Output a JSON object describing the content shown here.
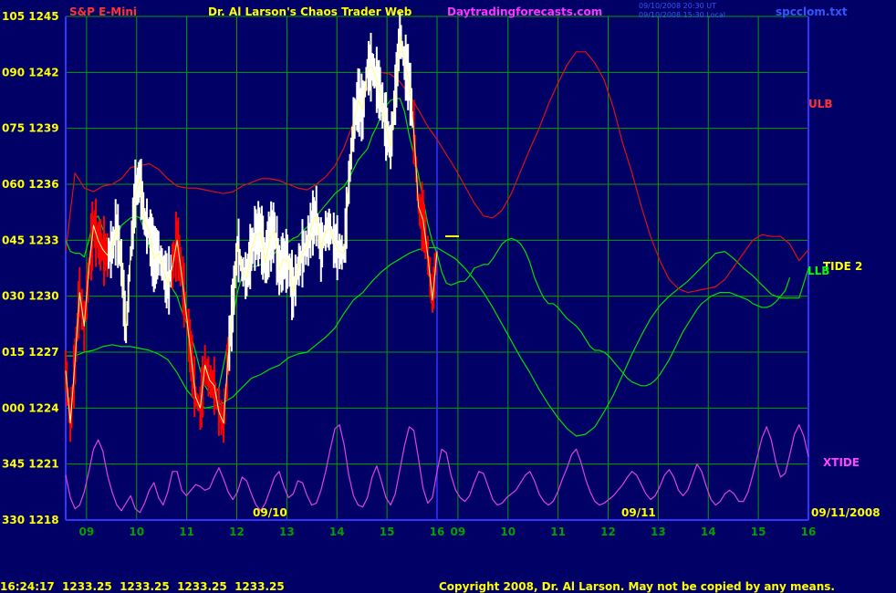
{
  "header": {
    "symbol": "S&P E-Mini",
    "title": "Dr. Al Larson's Chaos Trader Web",
    "site": "Daytradingforecasts.com",
    "stamp1": "09/10/2008 20:30 UT",
    "stamp2": "09/10/2008 15:30 Local",
    "file": "spcclom.txt"
  },
  "footer": {
    "quote": "16:24:17  1233.25  1233.25  1233.25  1233.25",
    "copyright": "Copyright 2008, Dr. Al Larson. May not be copied by any means."
  },
  "colors": {
    "background": "#000066",
    "grid": "#00a000",
    "axis": "#3333ff",
    "price_white": "#ffffff",
    "price_red": "#ff0000",
    "ulb": "#dd1111",
    "llb": "#00dd00",
    "xtide": "#dd44dd",
    "labels": "#ffff00"
  },
  "chart_data": {
    "type": "line",
    "y_tick_labels": [
      "105 1245",
      "090 1242",
      "075 1239",
      "060 1236",
      "045 1233",
      "030 1230",
      "015 1227",
      "000 1224",
      "345 1221",
      "330 1218"
    ],
    "x_tick_labels": [
      "09",
      "10",
      "11",
      "12",
      "13",
      "14",
      "15",
      "16",
      "09",
      "10",
      "11",
      "12",
      "13",
      "14",
      "15",
      "16"
    ],
    "date_labels": [
      "09/10",
      "09/11",
      "09/11/2008"
    ],
    "ylim": [
      1218,
      1245
    ],
    "series_labels": {
      "ulb": "ULB",
      "llb": "LLB",
      "tide": "TIDE 2",
      "xtide": "XTIDE"
    },
    "x_units": "slot (0 = left edge, 16 = right edge; day 1 09-16h = slots 0.45-8, day 2 09-16h = slots 8.45-16)",
    "price": {
      "x": [
        0.0,
        0.1,
        0.2,
        0.3,
        0.4,
        0.5,
        0.6,
        0.7,
        0.8,
        0.9,
        1.0,
        1.1,
        1.2,
        1.3,
        1.4,
        1.5,
        1.6,
        1.7,
        1.8,
        1.9,
        2.0,
        2.1,
        2.2,
        2.3,
        2.4,
        2.5,
        2.6,
        2.7,
        2.8,
        2.9,
        3.0,
        3.1,
        3.2,
        3.3,
        3.4,
        3.5,
        3.6,
        3.7,
        3.8,
        3.9,
        4.0,
        4.1,
        4.2,
        4.3,
        4.4,
        4.5,
        4.6,
        4.7,
        4.8,
        4.9,
        5.0,
        5.1,
        5.2,
        5.3,
        5.4,
        5.5,
        5.6,
        5.7,
        5.8,
        5.9,
        6.0,
        6.1,
        6.2,
        6.3,
        6.4,
        6.5,
        6.6,
        6.7,
        6.8,
        6.9,
        7.0,
        7.1,
        7.2,
        7.3,
        7.4,
        7.5,
        7.6,
        7.7,
        7.8,
        7.9,
        8.0
      ],
      "y": [
        1226.0,
        1223.2,
        1226.5,
        1230.2,
        1228.4,
        1231.5,
        1233.8,
        1233.0,
        1232.5,
        1232.2,
        1232.6,
        1233.7,
        1231.8,
        1228.0,
        1232.3,
        1235.5,
        1236.3,
        1234.0,
        1233.5,
        1232.0,
        1232.3,
        1231.5,
        1230.6,
        1231.6,
        1233.0,
        1231.1,
        1229.0,
        1226.8,
        1224.6,
        1224.0,
        1226.3,
        1225.5,
        1225.2,
        1223.8,
        1223.2,
        1226.8,
        1229.5,
        1232.8,
        1231.4,
        1231.0,
        1232.5,
        1233.3,
        1233.4,
        1231.8,
        1233.1,
        1233.5,
        1231.4,
        1232.0,
        1231.8,
        1230.2,
        1231.5,
        1232.3,
        1232.7,
        1233.8,
        1234.3,
        1232.5,
        1233.5,
        1233.6,
        1232.8,
        1232.4,
        1232.3,
        1236.1,
        1239.2,
        1240.5,
        1240.0,
        1242.2,
        1242.3,
        1241.6,
        1240.6,
        1239.1,
        1238.0,
        1240.8,
        1244.0,
        1242.5,
        1241.5,
        1238.8,
        1234.8,
        1234.1,
        1232.2,
        1229.8,
        1232.4
      ]
    },
    "ulb": {
      "x": [
        0.0,
        0.2,
        0.4,
        0.6,
        0.8,
        1.0,
        1.2,
        1.4,
        1.6,
        1.8,
        2.0,
        2.2,
        2.4,
        2.6,
        2.8,
        3.0,
        3.2,
        3.4,
        3.6,
        3.8,
        4.0,
        4.2,
        4.4,
        4.6,
        4.8,
        5.0,
        5.2,
        5.4,
        5.6,
        5.8,
        6.0,
        6.2,
        6.4,
        6.6,
        6.8,
        7.0,
        7.2,
        7.4,
        7.6,
        7.8,
        8.0,
        8.2,
        8.4,
        8.6,
        8.8,
        9.0,
        9.2,
        9.4,
        9.6,
        9.8,
        10.0,
        10.2,
        10.4,
        10.6,
        10.8,
        11.0,
        11.2,
        11.4,
        11.6,
        11.8,
        12.0,
        12.2,
        12.4,
        12.6,
        12.8,
        13.0,
        13.2,
        13.4,
        13.6,
        13.8,
        14.0,
        14.2,
        14.4,
        14.6,
        14.8,
        15.0,
        15.2,
        15.4,
        15.6,
        15.8,
        16.0
      ],
      "y": [
        1232.4,
        1236.6,
        1235.8,
        1235.6,
        1235.9,
        1236.0,
        1236.3,
        1236.9,
        1237.0,
        1237.1,
        1236.8,
        1236.3,
        1235.9,
        1235.8,
        1235.8,
        1235.7,
        1235.6,
        1235.5,
        1235.6,
        1235.9,
        1236.1,
        1236.3,
        1236.3,
        1236.2,
        1236.0,
        1235.8,
        1235.7,
        1236.0,
        1236.4,
        1237.0,
        1238.0,
        1239.3,
        1240.6,
        1241.7,
        1242.0,
        1241.9,
        1241.5,
        1240.8,
        1240.0,
        1239.1,
        1238.4,
        1237.6,
        1236.8,
        1235.9,
        1235.0,
        1234.3,
        1234.2,
        1234.6,
        1235.5,
        1236.7,
        1237.9,
        1239.0,
        1240.3,
        1241.4,
        1242.4,
        1243.1,
        1243.1,
        1242.5,
        1241.6,
        1240.1,
        1238.2,
        1236.6,
        1234.8,
        1233.2,
        1231.9,
        1230.9,
        1230.4,
        1230.2,
        1230.3,
        1230.4,
        1230.5,
        1230.9,
        1231.6,
        1232.3,
        1233.0,
        1233.3,
        1233.2,
        1233.2,
        1232.8,
        1231.9,
        1232.5
      ]
    },
    "llb": {
      "x": [
        0.0,
        0.2,
        0.4,
        0.6,
        0.8,
        1.0,
        1.2,
        1.4,
        1.6,
        1.8,
        2.0,
        2.2,
        2.4,
        2.6,
        2.8,
        3.0,
        3.2,
        3.4,
        3.6,
        3.8,
        4.0,
        4.2,
        4.4,
        4.6,
        4.8,
        5.0,
        5.2,
        5.4,
        5.6,
        5.8,
        6.0,
        6.2,
        6.4,
        6.6,
        6.8,
        7.0,
        7.2,
        7.4,
        7.6,
        7.8,
        8.0,
        8.2,
        8.4,
        8.6,
        8.8,
        9.0,
        9.2,
        9.4,
        9.6,
        9.8,
        10.0,
        10.2,
        10.4,
        10.6,
        10.8,
        11.0,
        11.2,
        11.4,
        11.6,
        11.8,
        12.0,
        12.2,
        12.4,
        12.6,
        12.8,
        13.0,
        13.2,
        13.4,
        13.6,
        13.8,
        14.0,
        14.2,
        14.4,
        14.6,
        14.8,
        15.0,
        15.2,
        15.4,
        15.6,
        15.8,
        16.0
      ],
      "y": [
        1226.8,
        1226.8,
        1227.0,
        1227.1,
        1227.3,
        1227.4,
        1227.3,
        1227.3,
        1227.2,
        1227.1,
        1226.9,
        1226.6,
        1225.9,
        1225.0,
        1224.4,
        1224.0,
        1224.1,
        1224.3,
        1224.6,
        1225.1,
        1225.6,
        1225.8,
        1226.1,
        1226.3,
        1226.7,
        1226.9,
        1227.0,
        1227.4,
        1227.8,
        1228.3,
        1229.1,
        1229.8,
        1230.2,
        1230.8,
        1231.3,
        1231.7,
        1232.0,
        1232.3,
        1232.5,
        1232.6,
        1232.6,
        1232.3,
        1232.0,
        1231.5,
        1230.9,
        1230.2,
        1229.4,
        1228.5,
        1227.6,
        1226.7,
        1225.9,
        1225.0,
        1224.2,
        1223.5,
        1222.9,
        1222.5,
        1222.6,
        1223.0,
        1223.8,
        1224.7,
        1225.8,
        1226.9,
        1227.9,
        1228.8,
        1229.5,
        1230.0,
        1230.4,
        1230.8,
        1231.3,
        1231.8,
        1232.3,
        1232.4,
        1232.0,
        1231.5,
        1231.1,
        1230.6,
        1230.1,
        1229.9,
        1229.9,
        1229.9,
        1231.5
      ]
    },
    "tide": {
      "x": [
        0.0,
        0.1,
        0.2,
        0.3,
        0.4,
        0.5,
        0.6,
        0.7,
        0.8,
        0.9,
        1.0,
        1.1,
        1.2,
        1.3,
        1.4,
        1.5,
        1.6,
        1.7,
        1.8,
        1.9,
        2.0,
        2.1,
        2.2,
        2.3,
        2.4,
        2.5,
        2.6,
        2.7,
        2.8,
        2.9,
        3.0,
        3.1,
        3.2,
        3.3,
        3.4,
        3.5,
        3.6,
        3.7,
        3.8,
        3.9,
        4.0,
        4.1,
        4.2,
        4.3,
        4.4,
        4.5,
        4.6,
        4.7,
        4.8,
        4.9,
        5.0,
        5.1,
        5.2,
        5.3,
        5.4,
        5.5,
        5.6,
        5.7,
        5.8,
        5.9,
        6.0,
        6.1,
        6.2,
        6.3,
        6.4,
        6.5,
        6.6,
        6.7,
        6.8,
        6.9,
        7.0,
        7.1,
        7.2,
        7.3,
        7.4,
        7.5,
        7.6,
        7.7,
        7.8,
        7.9,
        8.0,
        8.1,
        8.2,
        8.3,
        8.4,
        8.5,
        8.6,
        8.7,
        8.8,
        8.9,
        9.0,
        9.1,
        9.2,
        9.3,
        9.4,
        9.5,
        9.6,
        9.7,
        9.8,
        9.9,
        10.0,
        10.1,
        10.2,
        10.3,
        10.4,
        10.5,
        10.6,
        10.7,
        10.8,
        10.9,
        11.0,
        11.1,
        11.2,
        11.3,
        11.4,
        11.5,
        11.6,
        11.7,
        11.8,
        11.9,
        12.0,
        12.1,
        12.2,
        12.3,
        12.4,
        12.5,
        12.6,
        12.7,
        12.8,
        12.9,
        13.0,
        13.1,
        13.2,
        13.3,
        13.4,
        13.5,
        13.6,
        13.7,
        13.8,
        13.9,
        14.0,
        14.1,
        14.2,
        14.3,
        14.4,
        14.5,
        14.6,
        14.7,
        14.8,
        14.9,
        15.0,
        15.1,
        15.2,
        15.3,
        15.4,
        15.5,
        15.6,
        15.7,
        15.8,
        15.9,
        16.0
      ],
      "y": [
        1233.0,
        1232.4,
        1232.3,
        1232.3,
        1232.1,
        1233.0,
        1234.1,
        1234.3,
        1233.6,
        1232.9,
        1232.6,
        1233.2,
        1233.8,
        1234.0,
        1234.2,
        1234.3,
        1234.2,
        1233.5,
        1232.6,
        1232.8,
        1231.8,
        1231.6,
        1230.7,
        1230.4,
        1230.0,
        1229.2,
        1228.6,
        1227.9,
        1227.0,
        1226.0,
        1225.2,
        1224.8,
        1224.7,
        1225.1,
        1226.3,
        1227.6,
        1228.9,
        1230.2,
        1231.1,
        1231.5,
        1231.6,
        1231.6,
        1231.7,
        1231.9,
        1232.1,
        1232.3,
        1232.6,
        1232.7,
        1232.9,
        1233.1,
        1233.2,
        1233.5,
        1233.7,
        1234.0,
        1234.3,
        1234.6,
        1234.9,
        1235.2,
        1235.5,
        1235.7,
        1235.9,
        1236.3,
        1236.8,
        1237.3,
        1237.6,
        1237.9,
        1238.6,
        1239.1,
        1239.7,
        1240.2,
        1240.5,
        1240.6,
        1240.6,
        1239.9,
        1238.6,
        1237.6,
        1236.5,
        1235.2,
        1233.9,
        1232.9,
        1232.3,
        1231.3,
        1230.7,
        1230.6,
        1230.7,
        1230.8,
        1230.8,
        1231.1,
        1231.5,
        1231.6,
        1231.7,
        1231.7,
        1232.0,
        1232.4,
        1232.8,
        1233.0,
        1233.1,
        1233.0,
        1232.8,
        1232.4,
        1231.8,
        1231.0,
        1230.4,
        1229.9,
        1229.6,
        1229.6,
        1229.4,
        1229.1,
        1228.8,
        1228.6,
        1228.4,
        1228.1,
        1227.7,
        1227.3,
        1227.1,
        1227.1,
        1227.0,
        1226.8,
        1226.5,
        1226.2,
        1225.9,
        1225.6,
        1225.4,
        1225.3,
        1225.2,
        1225.2,
        1225.3,
        1225.5,
        1225.8,
        1226.2,
        1226.6,
        1227.1,
        1227.6,
        1228.1,
        1228.5,
        1228.9,
        1229.3,
        1229.6,
        1229.8,
        1230.0,
        1230.1,
        1230.2,
        1230.2,
        1230.2,
        1230.1,
        1230.0,
        1229.9,
        1229.8,
        1229.6,
        1229.5,
        1229.4,
        1229.4,
        1229.5,
        1229.7,
        1230.0,
        1230.3,
        1231.0
      ]
    },
    "xtide": {
      "x": [
        0.0,
        0.1,
        0.2,
        0.3,
        0.4,
        0.5,
        0.6,
        0.7,
        0.8,
        0.9,
        1.0,
        1.1,
        1.2,
        1.3,
        1.4,
        1.5,
        1.6,
        1.7,
        1.8,
        1.9,
        2.0,
        2.1,
        2.2,
        2.3,
        2.4,
        2.5,
        2.6,
        2.7,
        2.8,
        2.9,
        3.0,
        3.1,
        3.2,
        3.3,
        3.4,
        3.5,
        3.6,
        3.7,
        3.8,
        3.9,
        4.0,
        4.1,
        4.2,
        4.3,
        4.4,
        4.5,
        4.6,
        4.7,
        4.8,
        4.9,
        5.0,
        5.1,
        5.2,
        5.3,
        5.4,
        5.5,
        5.6,
        5.7,
        5.8,
        5.9,
        6.0,
        6.1,
        6.2,
        6.3,
        6.4,
        6.5,
        6.6,
        6.7,
        6.8,
        6.9,
        7.0,
        7.1,
        7.2,
        7.3,
        7.4,
        7.5,
        7.6,
        7.7,
        7.8,
        7.9,
        8.0,
        8.1,
        8.2,
        8.3,
        8.4,
        8.5,
        8.6,
        8.7,
        8.8,
        8.9,
        9.0,
        9.1,
        9.2,
        9.3,
        9.4,
        9.5,
        9.6,
        9.7,
        9.8,
        9.9,
        10.0,
        10.1,
        10.2,
        10.3,
        10.4,
        10.5,
        10.6,
        10.7,
        10.8,
        10.9,
        11.0,
        11.1,
        11.2,
        11.3,
        11.4,
        11.5,
        11.6,
        11.7,
        11.8,
        11.9,
        12.0,
        12.1,
        12.2,
        12.3,
        12.4,
        12.5,
        12.6,
        12.7,
        12.8,
        12.9,
        13.0,
        13.1,
        13.2,
        13.3,
        13.4,
        13.5,
        13.6,
        13.7,
        13.8,
        13.9,
        14.0,
        14.1,
        14.2,
        14.3,
        14.4,
        14.5,
        14.6,
        14.7,
        14.8,
        14.9,
        15.0,
        15.1,
        15.2,
        15.3,
        15.4,
        15.5,
        15.6,
        15.7,
        15.8,
        15.9,
        16.0
      ],
      "y": [
        1220.4,
        1219.2,
        1218.6,
        1218.8,
        1219.5,
        1220.6,
        1221.8,
        1222.3,
        1221.7,
        1220.4,
        1219.5,
        1218.8,
        1218.5,
        1218.9,
        1219.3,
        1218.6,
        1218.4,
        1218.9,
        1219.6,
        1220.0,
        1219.2,
        1218.8,
        1219.5,
        1220.6,
        1220.6,
        1219.6,
        1219.3,
        1219.6,
        1219.9,
        1219.8,
        1219.6,
        1219.7,
        1220.3,
        1220.8,
        1220.2,
        1219.5,
        1219.1,
        1219.5,
        1220.3,
        1220.1,
        1219.4,
        1218.8,
        1218.5,
        1218.9,
        1219.6,
        1220.3,
        1220.6,
        1219.8,
        1219.2,
        1219.4,
        1220.1,
        1220.0,
        1219.3,
        1218.8,
        1218.9,
        1219.6,
        1220.6,
        1221.8,
        1222.9,
        1223.1,
        1222.0,
        1220.4,
        1219.3,
        1218.8,
        1218.7,
        1219.2,
        1220.3,
        1220.9,
        1220.1,
        1219.2,
        1218.8,
        1219.4,
        1220.7,
        1222.0,
        1223.0,
        1222.8,
        1221.3,
        1219.7,
        1218.9,
        1219.2,
        1220.6,
        1221.8,
        1221.6,
        1220.4,
        1219.6,
        1219.2,
        1219.0,
        1219.3,
        1220.0,
        1220.6,
        1220.5,
        1219.8,
        1219.1,
        1218.8,
        1218.9,
        1219.2,
        1219.4,
        1219.6,
        1220.0,
        1220.4,
        1220.6,
        1220.1,
        1219.4,
        1219.0,
        1218.8,
        1219.0,
        1219.5,
        1220.2,
        1220.8,
        1221.5,
        1221.8,
        1221.1,
        1220.2,
        1219.5,
        1219.0,
        1218.8,
        1218.9,
        1219.1,
        1219.3,
        1219.6,
        1219.9,
        1220.3,
        1220.6,
        1220.4,
        1219.9,
        1219.4,
        1219.1,
        1219.3,
        1219.8,
        1220.4,
        1220.7,
        1220.3,
        1219.6,
        1219.3,
        1219.6,
        1220.3,
        1221.0,
        1220.6,
        1219.8,
        1219.1,
        1218.8,
        1219.0,
        1219.4,
        1219.6,
        1219.4,
        1219.0,
        1219.0,
        1219.5,
        1220.4,
        1221.4,
        1222.4,
        1223.0,
        1222.3,
        1221.1,
        1220.3,
        1220.5,
        1221.5,
        1222.6,
        1223.1,
        1222.5,
        1221.4
      ]
    }
  }
}
